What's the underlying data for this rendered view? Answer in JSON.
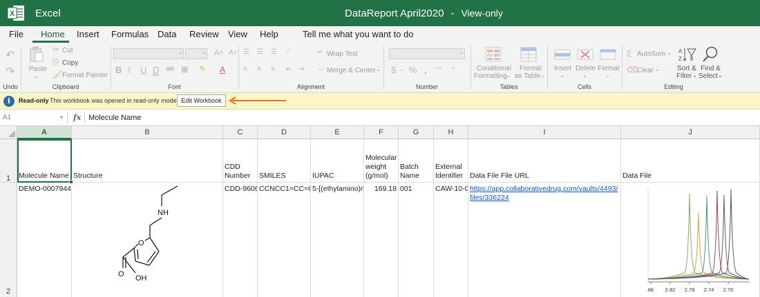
{
  "titlebar": {
    "app_name": "Excel",
    "doc_name": "DataReport April2020",
    "separator": "-",
    "mode": "View-only"
  },
  "menu": {
    "items": [
      "File",
      "Home",
      "Insert",
      "Formulas",
      "Data",
      "Review",
      "View",
      "Help"
    ],
    "active": "Home",
    "tell_me": "Tell me what you want to do"
  },
  "ribbon": {
    "clipboard": {
      "paste": "Paste",
      "cut": "Cut",
      "copy": "Copy",
      "format_painter": "Format Painter",
      "label": "Clipboard"
    },
    "undo_label": "Undo",
    "font": {
      "label": "Font"
    },
    "alignment": {
      "wrap_text": "Wrap Text",
      "merge_center": "Merge & Center",
      "label": "Alignment"
    },
    "number": {
      "label": "Number"
    },
    "tables": {
      "conditional_1": "Conditional",
      "conditional_2": "Formatting",
      "format_table_1": "Format",
      "format_table_2": "as Table",
      "label": "Tables"
    },
    "cells": {
      "insert": "Insert",
      "delete": "Delete",
      "format": "Format",
      "label": "Cells"
    },
    "editing": {
      "autosum": "AutoSum",
      "clear": "Clear",
      "sort_1": "Sort &",
      "sort_2": "Filter",
      "find_1": "Find &",
      "find_2": "Select",
      "label": "Editing"
    }
  },
  "infobar": {
    "title": "Read-only",
    "message": "This workbook was opened in read-only mode",
    "button": "Edit Workbook",
    "arrow_color": "#e8701a"
  },
  "formula_bar": {
    "cell_ref": "A1",
    "fx": "fx",
    "content": "Molecule Name"
  },
  "grid": {
    "columns": [
      "A",
      "B",
      "C",
      "D",
      "E",
      "F",
      "G",
      "H",
      "I",
      "J"
    ],
    "selected_column": "A",
    "rows": [
      "1",
      "2"
    ],
    "headers": {
      "A": "Molecule Name",
      "B": "Structure",
      "C": "CDD Number",
      "D": "SMILES",
      "E": "IUPAC",
      "F": "Molecular weight (g/mol)",
      "G": "Batch Name",
      "H": "External Identifier",
      "I": "Data File File URL",
      "J": "Data File"
    },
    "row2": {
      "A": "DEMO-0007944",
      "C": "CDD-9606",
      "D": "CCNCC1=CC=C(O",
      "E": "5-[(ethylamino)m",
      "F": "169.18",
      "G": "001",
      "H": "CAW-10-01",
      "I_line1": "https://app.collaborativedrug.com/vaults/4493/",
      "I_line2": "files/336224"
    },
    "structure_labels": {
      "nh": "NH",
      "o_ring": "O",
      "o_carbonyl": "O",
      "oh": "OH"
    },
    "spectrum_ticks": [
      ".86",
      "2.82",
      "2.78",
      "2.74",
      "2.70"
    ]
  },
  "colors": {
    "brand": "#217346",
    "info_bg": "#fcf5c6",
    "link": "#1155cc"
  }
}
